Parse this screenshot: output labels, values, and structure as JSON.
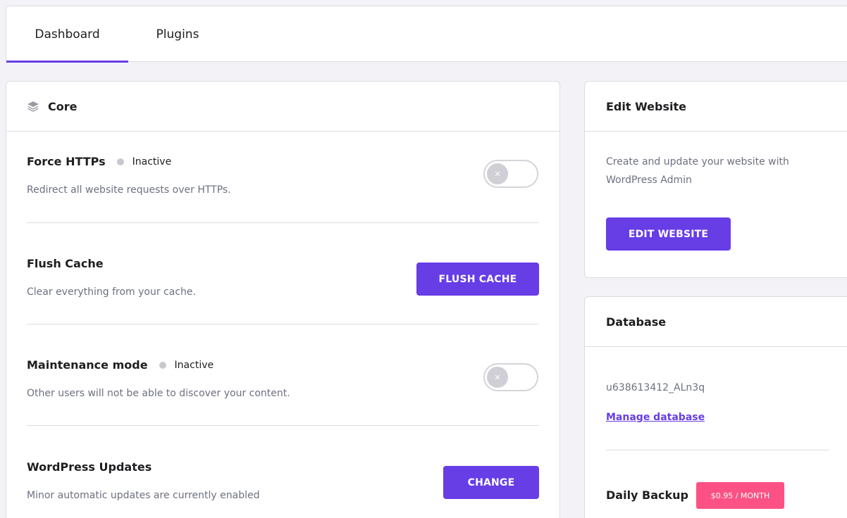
{
  "tabs": [
    {
      "label": "Dashboard",
      "active": true
    },
    {
      "label": "Plugins",
      "active": false
    }
  ],
  "core": {
    "title": "Core",
    "settings": {
      "force_https": {
        "title": "Force HTTPs",
        "status": "Inactive",
        "description": "Redirect all website requests over HTTPs.",
        "enabled": false
      },
      "flush_cache": {
        "title": "Flush Cache",
        "description": "Clear everything from your cache.",
        "button": "FLUSH CACHE"
      },
      "maintenance": {
        "title": "Maintenance mode",
        "status": "Inactive",
        "description": "Other users will not be able to discover your content.",
        "enabled": false
      },
      "wp_updates": {
        "title": "WordPress Updates",
        "description": "Minor automatic updates are currently enabled",
        "button": "CHANGE"
      }
    }
  },
  "edit_website": {
    "title": "Edit Website",
    "description": "Create and update your website with WordPress Admin",
    "button": "EDIT WEBSITE"
  },
  "database": {
    "title": "Database",
    "name": "u638613412_ALn3q",
    "link": "Manage database",
    "backup_title": "Daily Backup",
    "backup_price": "$0.95 / MONTH"
  },
  "colors": {
    "accent": "#673de6",
    "badge": "#fc5185",
    "background": "#f3f3f7"
  }
}
